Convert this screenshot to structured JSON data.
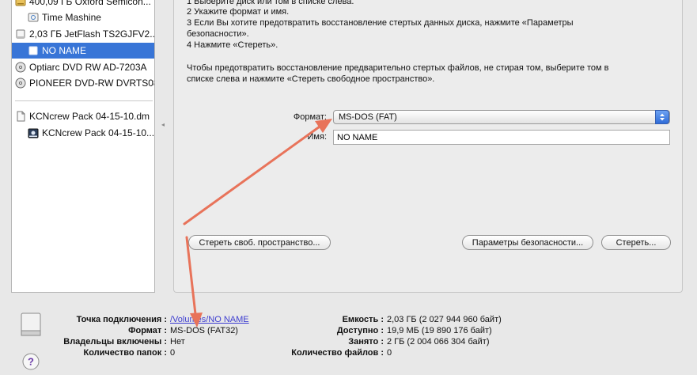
{
  "sidebar": {
    "items": [
      {
        "label": "400,09 ГБ Oxford Semicon...",
        "icon": "hard-drive-icon"
      },
      {
        "label": "Time Mashine",
        "icon": "volume-icon"
      },
      {
        "label": "2,03 ГБ JetFlash TS2GJFV2...",
        "icon": "usb-drive-icon"
      },
      {
        "label": "NO NAME",
        "icon": "volume-icon"
      },
      {
        "label": "Optiarc DVD RW AD-7203A",
        "icon": "optical-drive-icon"
      },
      {
        "label": "PIONEER DVD-RW DVRTS08",
        "icon": "optical-drive-icon"
      },
      {
        "label": "KCNcrew Pack 04-15-10.dm",
        "icon": "disk-image-icon"
      },
      {
        "label": "KCNcrew Pack 04-15-10...",
        "icon": "mounted-volume-icon"
      }
    ]
  },
  "panel": {
    "instructions": [
      "1  Выберите диск или том в списке слева.",
      "2  Укажите формат и имя.",
      "3  Если Вы хотите предотвратить восстановление стертых данных диска, нажмите «Параметры",
      "    безопасности».",
      "4  Нажмите «Стереть»."
    ],
    "note": [
      "Чтобы предотвратить восстановление предварительно стертых файлов, не стирая том, выберите том в",
      "списке слева и нажмите «Стереть свободное пространство»."
    ],
    "format_label": "Формат:",
    "format_value": "MS-DOS (FAT)",
    "name_label": "Имя:",
    "name_value": "NO NAME",
    "erase_free_space_button": "Стереть своб. пространство...",
    "security_options_button": "Параметры безопасности...",
    "erase_button": "Стереть..."
  },
  "info": {
    "mount_point_label": "Точка подключения :",
    "mount_point_value": "/Volumes/NO NAME",
    "format_label": "Формат :",
    "format_value": "MS-DOS (FAT32)",
    "owners_label": "Владельцы включены :",
    "owners_value": "Нет",
    "folders_label": "Количество папок :",
    "folders_value": "0",
    "capacity_label": "Емкость :",
    "capacity_value": "2,03 ГБ (2 027 944 960 байт)",
    "available_label": "Доступно :",
    "available_value": "19,9 МБ (19 890 176 байт)",
    "used_label": "Занято :",
    "used_value": "2 ГБ (2 004 066 304 байт)",
    "files_label": "Количество файлов :",
    "files_value": "0"
  },
  "colors": {
    "selection": "#3875d7",
    "annotation_arrow": "#e8735a",
    "link": "#3c3cd0"
  }
}
